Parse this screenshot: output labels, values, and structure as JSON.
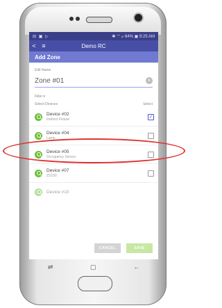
{
  "statusbar": {
    "icons": "⊟ ▣ ▷",
    "right": "✱ ⌔ ᵢₗₗ 64% ▣ 9:25 AM"
  },
  "appbar": {
    "back_icon": "<",
    "menu_icon": "≡",
    "title": "Demo RC"
  },
  "subheader": {
    "title": "Add Zone"
  },
  "name_field": {
    "label": "Edit Name",
    "value": "Zone #01",
    "clear_icon": "×"
  },
  "filter": {
    "label": "Filter ▾"
  },
  "list": {
    "header_left": "Select Devices",
    "header_right": "Select",
    "items": [
      {
        "name": "Device #02",
        "type": "Indirect Fixture",
        "checked": true
      },
      {
        "name": "Device #04",
        "type": "Lamp",
        "checked": false
      },
      {
        "name": "Device #05",
        "type": "Occupancy Sensor",
        "checked": false
      },
      {
        "name": "Device #07",
        "type": "ZS100",
        "checked": false
      },
      {
        "name": "Device #10",
        "type": "",
        "checked": false
      }
    ]
  },
  "footer": {
    "cancel": "CANCEL",
    "save": "SAVE"
  },
  "navbar": {
    "recent": "⇌",
    "home": "▢",
    "back": "←"
  },
  "colors": {
    "statusbar": "#3b3f87",
    "appbar": "#474ea5",
    "subheader": "#6f7ad0",
    "accent_green": "#6bbf3a",
    "highlight": "#e03030"
  }
}
